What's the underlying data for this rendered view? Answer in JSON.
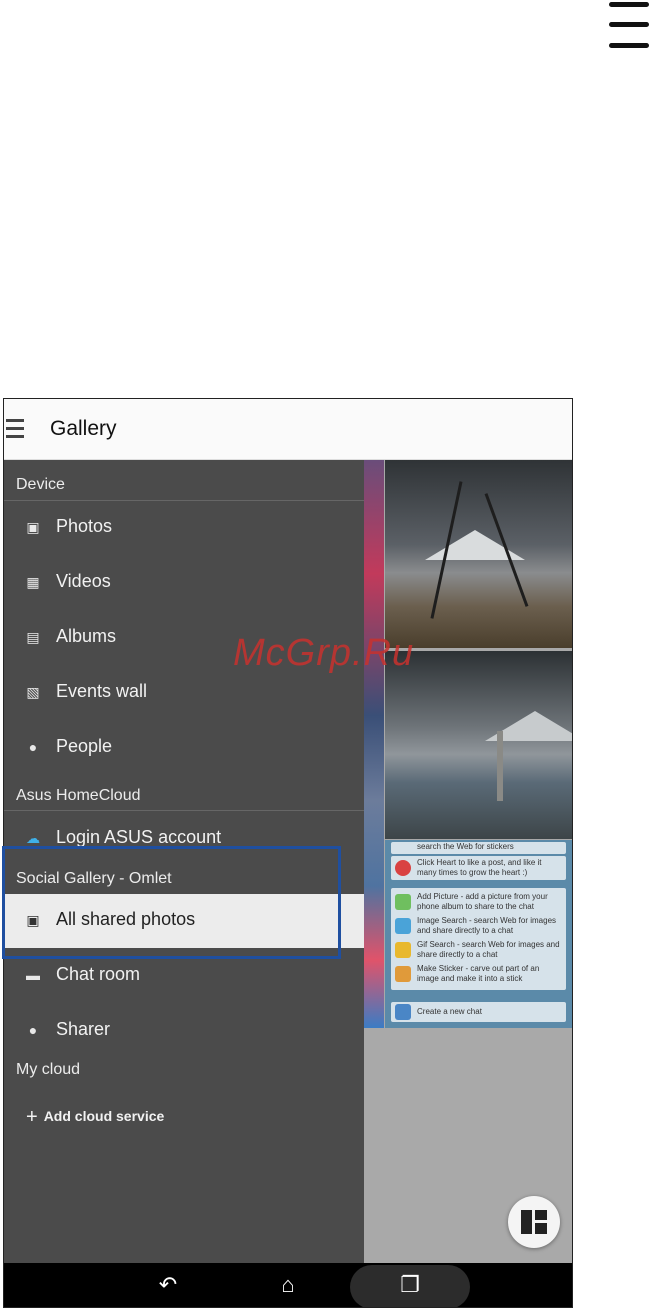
{
  "app": {
    "title": "Gallery"
  },
  "drawer": {
    "sections": {
      "device": "Device",
      "homecloud": "Asus HomeCloud",
      "social": "Social Gallery - Omlet",
      "mycloud": "My cloud"
    },
    "device_items": [
      {
        "label": "Photos",
        "icon": "photos-icon"
      },
      {
        "label": "Videos",
        "icon": "videos-icon"
      },
      {
        "label": "Albums",
        "icon": "albums-icon"
      },
      {
        "label": "Events wall",
        "icon": "events-wall-icon"
      },
      {
        "label": "People",
        "icon": "people-icon"
      }
    ],
    "homecloud_items": [
      {
        "label": "Login ASUS account",
        "icon": "cloud-icon"
      }
    ],
    "social_items": [
      {
        "label": "All shared photos",
        "icon": "shared-photos-icon",
        "selected": true
      },
      {
        "label": "Chat room",
        "icon": "chat-icon"
      },
      {
        "label": "Sharer",
        "icon": "sharer-icon"
      }
    ],
    "add_cloud": "Add cloud service"
  },
  "help_card": [
    {
      "text": "search the Web for stickers"
    },
    {
      "text": "Click Heart to like a post, and like it many times to grow the heart :)"
    },
    {
      "text": "Add Picture - add a picture from your phone album to share to the chat"
    },
    {
      "text": "Image Search - search Web for images and share directly to a chat"
    },
    {
      "text": "Gif Search - search Web for images and share directly to a chat"
    },
    {
      "text": "Make Sticker - carve out part of an image and make it into a stick"
    },
    {
      "text": "Create a new chat"
    }
  ],
  "watermark": "McGrp.Ru",
  "colors": {
    "drawer_bg": "#4b4b4b",
    "selected_bg": "#ececec",
    "highlight": "#1f4fa0"
  }
}
